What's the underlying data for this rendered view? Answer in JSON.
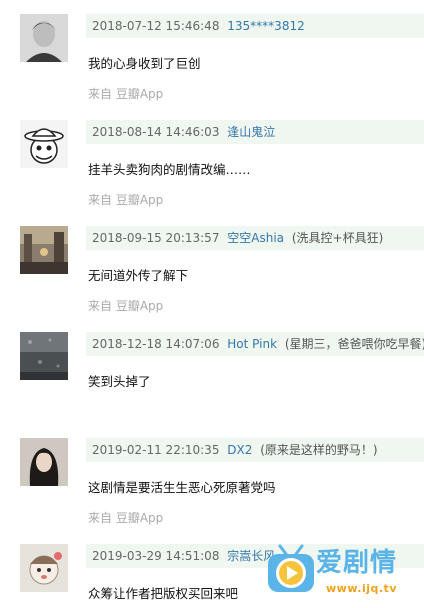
{
  "source_label": "来自 豆瓣App",
  "comments": [
    {
      "time": "2018-07-12 15:46:48",
      "user": "135****3812",
      "signature": "",
      "text": "我的心身收到了巨创",
      "source": "来自 豆瓣App",
      "avatar_icon": "person-portrait-avatar"
    },
    {
      "time": "2018-08-14 14:46:03",
      "user": "逢山鬼泣",
      "signature": "",
      "text": "挂羊头卖狗肉的剧情改编……",
      "source": "来自 豆瓣App",
      "avatar_icon": "cartoon-straw-hat-avatar"
    },
    {
      "time": "2018-09-15 20:13:57",
      "user": "空空Ashia",
      "signature": "(洗具控+杯具狂)",
      "text": "无间道外传了解下",
      "source": "来自 豆瓣App",
      "avatar_icon": "city-street-avatar"
    },
    {
      "time": "2018-12-18 14:07:06",
      "user": "Hot Pink",
      "signature": "(星期三，爸爸喂你吃早餐)",
      "text": "笑到头掉了",
      "source": "",
      "avatar_icon": "rainy-window-avatar"
    },
    {
      "time": "2019-02-11 22:10:35",
      "user": "DX2",
      "signature": "(原来是这样的野马！)",
      "text": "这剧情是要活生生恶心死原著党吗",
      "source": "来自 豆瓣App",
      "avatar_icon": "girl-portrait-avatar"
    },
    {
      "time": "2019-03-29 14:51:08",
      "user": "宗嵩长风",
      "signature": "",
      "text": "众筹让作者把版权买回来吧",
      "source": "",
      "avatar_icon": "cartoon-doll-avatar"
    }
  ],
  "watermark": {
    "brand": "爱剧情",
    "url": "www.ijq.tv",
    "brand_color": "#5bb4e8",
    "url_color": "#f0a21b"
  },
  "colors": {
    "meta_bg": "#f0f6f0",
    "user_link": "#3377aa",
    "muted": "#aaaaaa"
  }
}
